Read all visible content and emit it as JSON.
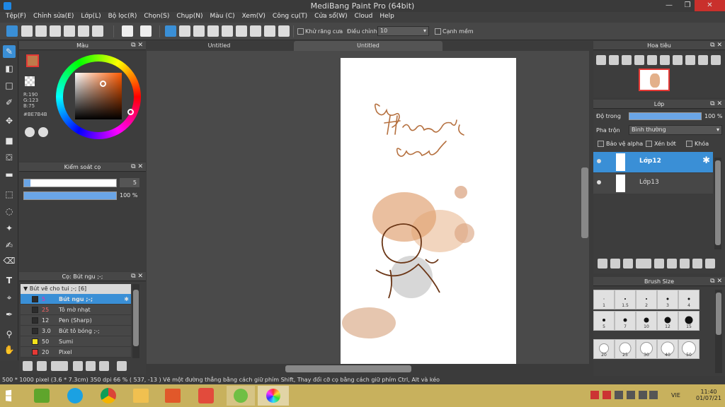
{
  "title": "MediBang Paint Pro (64bit)",
  "menu": [
    "Tệp(F)",
    "Chỉnh sửa(E)",
    "Lớp(L)",
    "Bộ lọc(R)",
    "Chọn(S)",
    "Chụp(N)",
    "Màu (C)",
    "Xem(V)",
    "Công cụ(T)",
    "Cửa sổ(W)",
    "Cloud",
    "Help"
  ],
  "toolbar": {
    "antialias_label": "Khử răng cưa",
    "correction_label": "Điều chỉnh",
    "correction_value": "10",
    "soft_edge_label": "Cạnh mềm"
  },
  "color_panel": {
    "title": "Màu",
    "r": "R:190",
    "g": "G:123",
    "b": "B:75",
    "hex": "#BE7B4B",
    "color": "#BE7B4B"
  },
  "brush_control": {
    "title": "Kiểm soát cọ",
    "size": "5",
    "opacity": "100 %"
  },
  "brush_panel": {
    "title": "Cọ: Bút ngu ;-;",
    "group": "Bút vẽ cho tui ;-; [6]",
    "items": [
      {
        "size": "5",
        "name": "Bút ngu ;-;",
        "color": "#2c2c2c",
        "sel": true
      },
      {
        "size": "25",
        "name": "Tô mờ nhạt",
        "color": "#2c2c2c"
      },
      {
        "size": "12",
        "name": "Pen (Sharp)",
        "color": "#2c2c2c"
      },
      {
        "size": "3.0",
        "name": "Bút tô bóng ;-;",
        "color": "#2c2c2c"
      },
      {
        "size": "50",
        "name": "Sumi",
        "color": "#f2e21a"
      },
      {
        "size": "20",
        "name": "Pixel",
        "color": "#e53935"
      }
    ]
  },
  "tabs": [
    "Untitled",
    "Untitled"
  ],
  "navigator": {
    "title": "Hoa tiêu"
  },
  "layer_panel": {
    "title": "Lớp",
    "opacity_label": "Độ trong",
    "opacity_value": "100 %",
    "blend_label": "Pha trộn",
    "blend_value": "Bình thường",
    "protect_alpha": "Bảo vệ alpha",
    "clipping": "Xén bớt",
    "lock": "Khóa",
    "layers": [
      {
        "name": "Lớp12",
        "sel": true
      },
      {
        "name": "Lớp13",
        "sel": false
      }
    ]
  },
  "brush_size": {
    "title": "Brush Size",
    "sizes": [
      "1",
      "1.5",
      "2",
      "3",
      "4",
      "5",
      "7",
      "10",
      "12",
      "15",
      "20",
      "25",
      "30",
      "40",
      "50"
    ]
  },
  "status": "500 * 1000 pixel   (3.6 * 7.3cm)   350 dpi   66 %   ( 537, -13 )   Vẽ một đường thẳng bằng cách giữ phím Shift, Thay đổi cỡ cọ bằng cách giữ phím Ctrl, Alt và kéo",
  "taskbar": {
    "lang": "VIE",
    "time": "11:40",
    "date": "01/07/21"
  }
}
